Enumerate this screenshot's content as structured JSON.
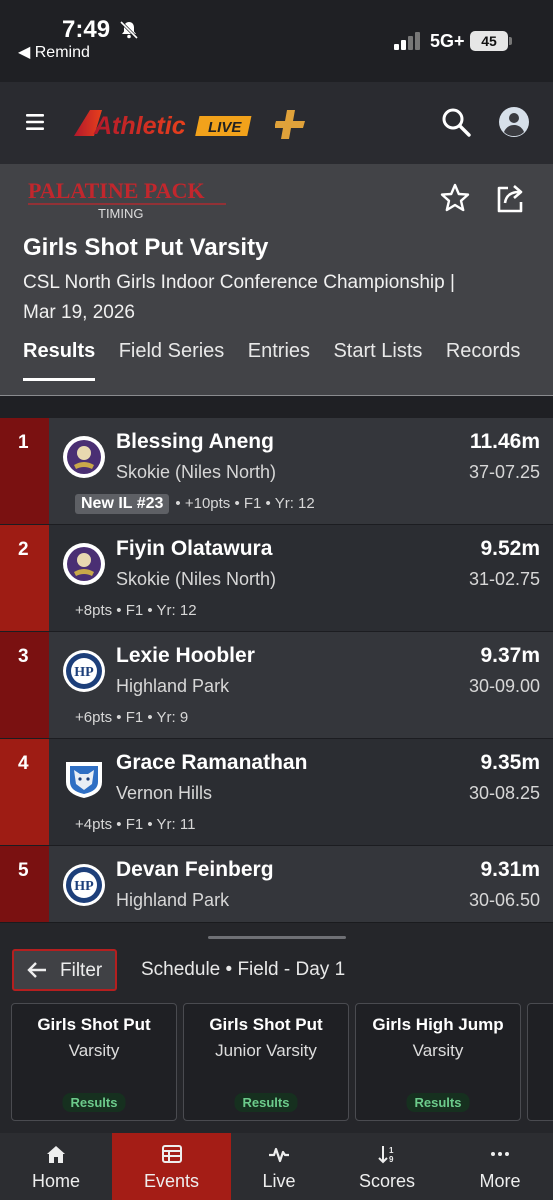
{
  "status_bar": {
    "time": "7:49",
    "back_label": "◀ Remind",
    "network": "5G+",
    "battery": "45"
  },
  "app": {
    "logo_text": "Athletic",
    "logo_badge": "LIVE"
  },
  "org": {
    "name_line1": "PALATINE PACK",
    "name_line2": "TIMING"
  },
  "event": {
    "title": "Girls Shot Put Varsity",
    "meet_line1": "CSL North Girls Indoor Conference Championship |",
    "meet_line2": "Mar 19, 2026"
  },
  "tabs": [
    "Results",
    "Field Series",
    "Entries",
    "Start Lists",
    "Records"
  ],
  "results": [
    {
      "place": "1",
      "name": "Blessing Aneng",
      "team": "Skokie (Niles North)",
      "mark": "11.46m",
      "imperial": "37-07.25",
      "badge": "New IL #23",
      "meta": "• +10pts • F1 • Yr: 12",
      "logo": "vikings-logo"
    },
    {
      "place": "2",
      "name": "Fiyin Olatawura",
      "team": "Skokie (Niles North)",
      "mark": "9.52m",
      "imperial": "31-02.75",
      "badge": "",
      "meta": "+8pts • F1 • Yr: 12",
      "logo": "vikings-logo"
    },
    {
      "place": "3",
      "name": "Lexie Hoobler",
      "team": "Highland Park",
      "mark": "9.37m",
      "imperial": "30-09.00",
      "badge": "",
      "meta": "+6pts • F1 • Yr: 9",
      "logo": "giants-logo"
    },
    {
      "place": "4",
      "name": "Grace Ramanathan",
      "team": "Vernon Hills",
      "mark": "9.35m",
      "imperial": "30-08.25",
      "badge": "",
      "meta": "+4pts • F1 • Yr: 11",
      "logo": "cougar-logo"
    },
    {
      "place": "5",
      "name": "Devan Feinberg",
      "team": "Highland Park",
      "mark": "9.31m",
      "imperial": "30-06.50",
      "badge": "",
      "meta": "",
      "logo": "giants-logo"
    }
  ],
  "sheet": {
    "filter_label": "Filter",
    "schedule_label": "Schedule • Field - Day 1",
    "cards": [
      {
        "name": "Girls Shot Put",
        "level": "Varsity",
        "status": "Results"
      },
      {
        "name": "Girls Shot Put",
        "level": "Junior Varsity",
        "status": "Results"
      },
      {
        "name": "Girls High Jump",
        "level": "Varsity",
        "status": "Results"
      }
    ]
  },
  "tabbar": [
    {
      "label": "Home",
      "icon": "home-icon"
    },
    {
      "label": "Events",
      "icon": "events-icon"
    },
    {
      "label": "Live",
      "icon": "pulse-icon"
    },
    {
      "label": "Scores",
      "icon": "sort-icon"
    },
    {
      "label": "More",
      "icon": "more-icon"
    }
  ],
  "colors": {
    "accent": "#a41d16",
    "place_dark": "#7a1111",
    "badge_green": "#6ccb8b",
    "logo_orange": "#f2a21b"
  }
}
